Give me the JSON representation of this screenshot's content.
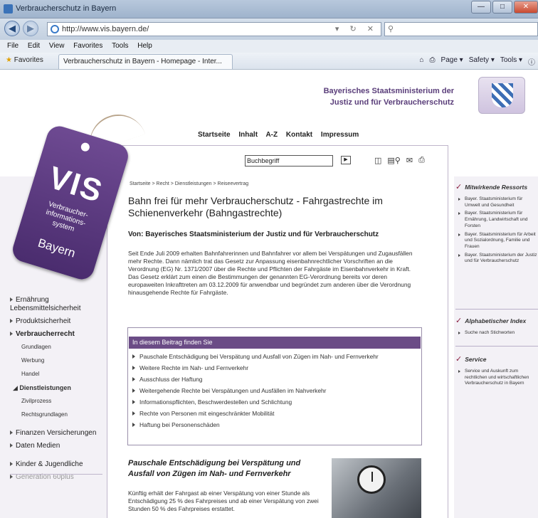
{
  "browser": {
    "window_title": "Verbraucherschutz in Bayern",
    "url": "http://www.vis.bayern.de/",
    "menu": [
      "File",
      "Edit",
      "View",
      "Favorites",
      "Tools",
      "Help"
    ],
    "favorites_label": "Favorites",
    "tab_title": "Verbraucherschutz in Bayern - Homepage - Inter...",
    "commands": [
      "Page ▾",
      "Safety ▾",
      "Tools ▾"
    ]
  },
  "header": {
    "ministry_line1": "Bayerisches Staatsministerium der",
    "ministry_line2": "Justiz und für Verbraucherschutz",
    "nav": [
      "Startseite",
      "Inhalt",
      "A-Z",
      "Kontakt",
      "Impressum"
    ]
  },
  "logo": {
    "text": "VIS",
    "subtitle_line1": "Verbraucher-",
    "subtitle_line2": "informations-",
    "subtitle_line3": "system",
    "region": "Bayern"
  },
  "search": {
    "placeholder": "Buchbegriff"
  },
  "leftnav": {
    "items": [
      {
        "label": "Ernährung Lebensmittelsicherheit",
        "level": 1
      },
      {
        "label": "Produktsicherheit",
        "level": 1
      },
      {
        "label": "Verbraucherrecht",
        "level": 1,
        "active": true
      },
      {
        "label": "Grundlagen",
        "level": 2
      },
      {
        "label": "Werbung",
        "level": 2
      },
      {
        "label": "Handel",
        "level": 2
      },
      {
        "label": "Dienstleistungen",
        "level": 2,
        "active": true
      },
      {
        "label": "Zivilprozess",
        "level": 2
      },
      {
        "label": "Rechtsgrundlagen",
        "level": 2
      },
      {
        "label": "Finanzen Versicherungen",
        "level": 1
      },
      {
        "label": "Daten Medien",
        "level": 1
      },
      {
        "label": "Kinder & Jugendliche",
        "level": 1
      },
      {
        "label": "Generation 60plus",
        "level": 1
      }
    ]
  },
  "article": {
    "breadcrumb": "Startseite > Recht > Dienstleistungen > Reiseevertrag",
    "title": "Bahn frei für mehr Verbraucherschutz - Fahrgastrechte im Schienenverkehr (Bahngastrechte)",
    "author": "Von: Bayerisches Staatsministerium der Justiz und für Verbraucherschutz",
    "intro": "Seit Ende Juli 2009 erhalten Bahnfahrerinnen und Bahnfahrer vor allem bei Verspätungen und Zugausfällen mehr Rechte. Dann nämlich trat das Gesetz zur Anpassung eisenbahnrechtlicher Vorschriften an die Verordnung (EG) Nr. 1371/2007 über die Rechte und Pflichten der Fahrgäste im Eisenbahnverkehr in Kraft. Das Gesetz erklärt zum einen die Bestimmungen der genannten EG-Verordnung bereits vor deren europaweiten Inkrafttreten am 03.12.2009 für anwendbar und begründet zum anderen über die Verordnung hinausgehende Rechte für Fahrgäste.",
    "toc_header": "In diesem Beitrag finden Sie",
    "toc": [
      "Pauschale Entschädigung bei Verspätung und Ausfall von Zügen im Nah- und Fernverkehr",
      "Weitere Rechte im Nah- und Fernverkehr",
      "Ausschluss der Haftung",
      "Weitergehende Rechte bei Verspätungen und Ausfällen im Nahverkehr",
      "Informationspflichten, Beschwerdestellen und Schlichtung",
      "Rechte von Personen mit eingeschränkter Mobilität",
      "Haftung bei Personenschäden"
    ],
    "section_title": "Pauschale Entschädigung bei Verspätung und Ausfall von Zügen im Nah- und Fernverkehr",
    "section_text": "Künftig erhält der Fahrgast ab einer Verspätung von einer Stunde als Entschädigung 25 % des Fahrpreises und ab einer Verspätung von zwei Stunden 50 % des Fahrpreises erstattet."
  },
  "rightcol": {
    "ressorts_title": "Mitwirkende Ressorts",
    "ressorts": [
      "Bayer. Staatsministerium für Umwelt und Gesundheit",
      "Bayer. Staatsministerium für Ernährung, Landwirtschaft und Forsten",
      "Bayer. Staatsministerium für Arbeit und Sozialordnung, Familie und Frauen",
      "Bayer. Staatsministerium der Justiz und für Verbraucherschutz"
    ],
    "index_title": "Alphabetischer Index",
    "index_link": "Suche nach Stichworten",
    "service_title": "Service",
    "service_text": "Service und Auskunft zum rechtlichen und wirtschaftlichen Verbraucherschutz in Bayern"
  },
  "colors": {
    "accent": "#6b4c86",
    "brand_text": "#5a3e7a"
  }
}
